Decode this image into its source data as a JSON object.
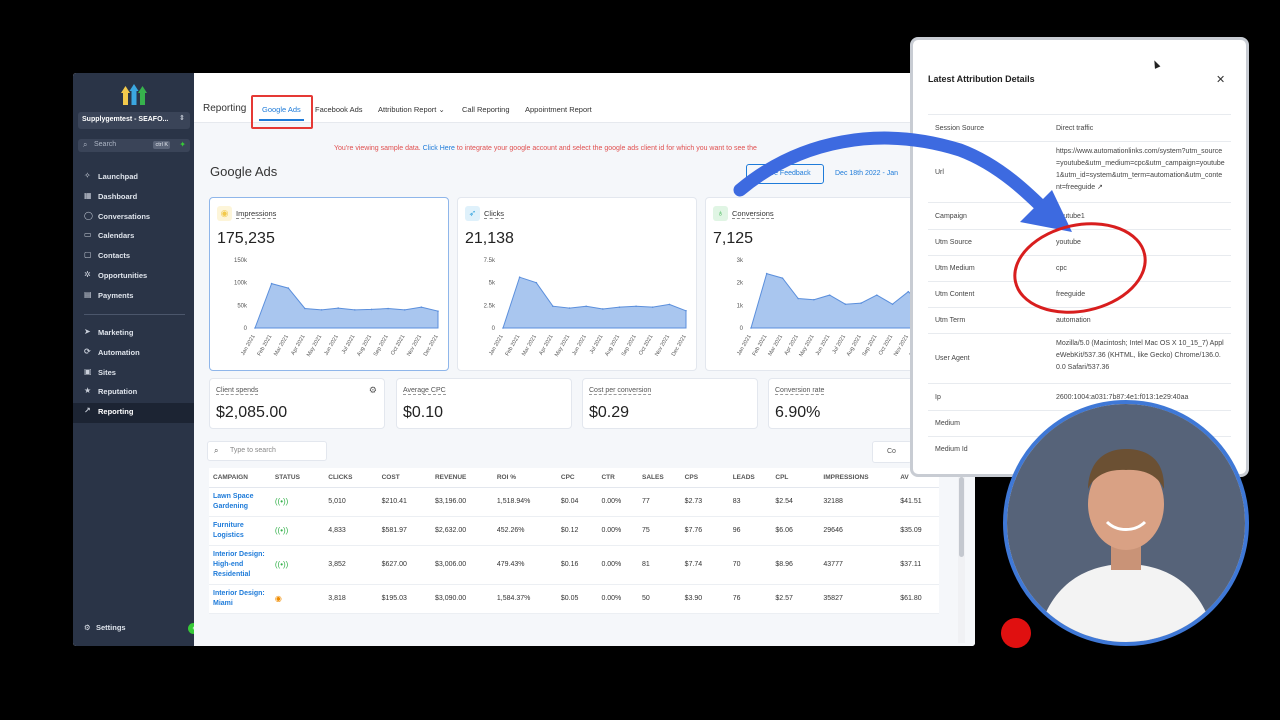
{
  "sidebar": {
    "location": "Supplygemtest - SEAFO...",
    "search": {
      "placeholder": "Search",
      "shortcut": "ctrl K"
    },
    "items": [
      {
        "label": "Launchpad",
        "icon": "rocket-icon"
      },
      {
        "label": "Dashboard",
        "icon": "dashboard-icon"
      },
      {
        "label": "Conversations",
        "icon": "chat-icon"
      },
      {
        "label": "Calendars",
        "icon": "calendar-icon"
      },
      {
        "label": "Contacts",
        "icon": "contacts-icon"
      },
      {
        "label": "Opportunities",
        "icon": "opportunities-icon"
      },
      {
        "label": "Payments",
        "icon": "payments-icon"
      }
    ],
    "items2": [
      {
        "label": "Marketing",
        "icon": "send-icon"
      },
      {
        "label": "Automation",
        "icon": "automation-icon"
      },
      {
        "label": "Sites",
        "icon": "sites-icon"
      },
      {
        "label": "Reputation",
        "icon": "star-icon"
      },
      {
        "label": "Reporting",
        "icon": "reporting-icon",
        "active": true
      }
    ],
    "settings": "Settings"
  },
  "header": {
    "title": "Reporting",
    "tabs": [
      "Google Ads",
      "Facebook Ads",
      "Attribution Report ⌄",
      "Call Reporting",
      "Appointment Report"
    ],
    "active_tab": "Google Ads"
  },
  "banner": {
    "pre": "You're viewing sample data. ",
    "link": "Click Here",
    "post": " to integrate your google account and select the google ads client id for which you want to see the"
  },
  "page": {
    "title": "Google Ads",
    "feedback": "Share Feedback",
    "date_range": "Dec 18th 2022 - Jan"
  },
  "metrics": [
    {
      "name": "Impressions",
      "value": "175,235",
      "color": "#f2c94c",
      "bg": "#fdf5d9",
      "icon": "eye-icon",
      "yticks": [
        "150k",
        "100k",
        "50k",
        "0"
      ],
      "ymax": 150000,
      "points": [
        0,
        98000,
        88000,
        43000,
        40000,
        44000,
        40000,
        41000,
        43000,
        40000,
        46000,
        37000
      ]
    },
    {
      "name": "Clicks",
      "value": "21,138",
      "color": "#3ba7e0",
      "bg": "#dff1fb",
      "icon": "cursor-icon",
      "yticks": [
        "7.5k",
        "5k",
        "2.5k",
        "0"
      ],
      "ymax": 7500,
      "points": [
        0,
        5600,
        5000,
        2400,
        2200,
        2400,
        2100,
        2300,
        2400,
        2300,
        2600,
        1900
      ]
    },
    {
      "name": "Conversions",
      "value": "7,125",
      "color": "#37b24d",
      "bg": "#e0f5e4",
      "icon": "bulb-icon",
      "yticks": [
        "3k",
        "2k",
        "1k",
        "0"
      ],
      "ymax": 3000,
      "points": [
        0,
        2400,
        2200,
        1300,
        1250,
        1450,
        1050,
        1100,
        1450,
        1050,
        1600,
        1000
      ]
    }
  ],
  "months": [
    "Jan 2021",
    "Feb 2021",
    "Mar 2021",
    "Apr 2021",
    "May 2021",
    "Jun 2021",
    "Jul 2021",
    "Aug 2021",
    "Sep 2021",
    "Oct 2021",
    "Nov 2021",
    "Dec 2021"
  ],
  "stats": [
    {
      "label": "Client spends",
      "value": "$2,085.00"
    },
    {
      "label": "Average CPC",
      "value": "$0.10"
    },
    {
      "label": "Cost per conversion",
      "value": "$0.29"
    },
    {
      "label": "Conversion rate",
      "value": "6.90%"
    }
  ],
  "table": {
    "search_placeholder": "Type to search",
    "columns_btn": "Co",
    "headers": [
      "CAMPAIGN",
      "STATUS",
      "CLICKS",
      "COST",
      "REVENUE",
      "ROI %",
      "CPC",
      "CTR",
      "SALES",
      "CPS",
      "LEADS",
      "CPL",
      "IMPRESSIONS",
      "AV"
    ],
    "rows": [
      {
        "campaign": "Lawn Space Gardening",
        "status": "on",
        "clicks": "5,010",
        "cost": "$210.41",
        "revenue": "$3,196.00",
        "roi": "1,518.94%",
        "cpc": "$0.04",
        "ctr": "0.00%",
        "sales": "77",
        "cps": "$2.73",
        "leads": "83",
        "cpl": "$2.54",
        "impressions": "32188",
        "av": "$41.51"
      },
      {
        "campaign": "Furniture Logistics",
        "status": "on",
        "clicks": "4,833",
        "cost": "$581.97",
        "revenue": "$2,632.00",
        "roi": "452.26%",
        "cpc": "$0.12",
        "ctr": "0.00%",
        "sales": "75",
        "cps": "$7.76",
        "leads": "96",
        "cpl": "$6.06",
        "impressions": "29646",
        "av": "$35.09"
      },
      {
        "campaign": "Interior Design: High-end Residential",
        "status": "on",
        "clicks": "3,852",
        "cost": "$627.00",
        "revenue": "$3,006.00",
        "roi": "479.43%",
        "cpc": "$0.16",
        "ctr": "0.00%",
        "sales": "81",
        "cps": "$7.74",
        "leads": "70",
        "cpl": "$8.96",
        "impressions": "43777",
        "av": "$37.11"
      },
      {
        "campaign": "Interior Design: Miami",
        "status": "paused",
        "clicks": "3,818",
        "cost": "$195.03",
        "revenue": "$3,090.00",
        "roi": "1,584.37%",
        "cpc": "$0.05",
        "ctr": "0.00%",
        "sales": "50",
        "cps": "$3.90",
        "leads": "76",
        "cpl": "$2.57",
        "impressions": "35827",
        "av": "$61.80"
      }
    ]
  },
  "modal": {
    "title": "Latest Attribution Details",
    "rows": [
      {
        "k": "Session Source",
        "v": "Direct traffic"
      },
      {
        "k": "Url",
        "v": "https://www.automationlinks.com/system?utm_source=youtube&utm_medium=cpc&utm_campaign=youtube1&utm_id=system&utm_term=automation&utm_content=freeguide ↗"
      },
      {
        "k": "Campaign",
        "v": "youtube1"
      },
      {
        "k": "Utm Source",
        "v": "youtube"
      },
      {
        "k": "Utm Medium",
        "v": "cpc"
      },
      {
        "k": "Utm Content",
        "v": "freeguide"
      },
      {
        "k": "Utm Term",
        "v": "automation"
      },
      {
        "k": "User Agent",
        "v": "Mozilla/5.0 (Macintosh; Intel Mac OS X 10_15_7) AppleWebKit/537.36 (KHTML, like Gecko) Chrome/136.0.0.0 Safari/537.36"
      },
      {
        "k": "Ip",
        "v": "2600:1004:a031:7b87:4e1:f013:1e29:40aa"
      },
      {
        "k": "Medium",
        "v": ""
      },
      {
        "k": "Medium Id",
        "v": ""
      }
    ]
  },
  "colors": {
    "accent": "#1e7bd9",
    "sidebar": "#2a3447",
    "arrow": "#3d6ae0",
    "circle": "#d81e1e"
  }
}
